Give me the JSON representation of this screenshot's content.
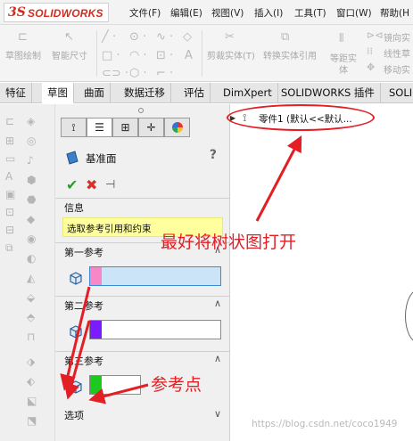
{
  "app": {
    "logo_ds": "3S",
    "logo_text": "SOLIDWORKS"
  },
  "menu": {
    "items": [
      "文件(F)",
      "编辑(E)",
      "视图(V)",
      "插入(I)",
      "工具(T)",
      "窗口(W)",
      "帮助(H"
    ]
  },
  "toolbar": {
    "sketch_draw": "草图绘制",
    "smart_dim": "智能尺寸",
    "trim_entities": "剪裁实体(T)",
    "convert_entities": "转换实体引用",
    "offset_entities_1": "等距实",
    "offset_entities_2": "体",
    "mirror_entities": "镜向实",
    "linear_pattern": "线性草",
    "move_entities": "移动实"
  },
  "tabs": [
    "特征",
    "草图",
    "曲面",
    "数据迁移",
    "评估",
    "DimXpert",
    "SOLIDWORKS 插件",
    "SOLI"
  ],
  "active_tab": 1,
  "panel": {
    "title": "基准面",
    "help": "?",
    "sections": {
      "info": "信息",
      "first_ref": "第一参考",
      "second_ref": "第二参考",
      "third_ref": "第三参考",
      "options": "选项"
    },
    "info_message": "选取参考引用和约束",
    "colors": {
      "first_ref": "#f787c6",
      "second_ref": "#7b1cff",
      "third_ref": "#1ec81e"
    }
  },
  "tree": {
    "part_label": "零件1  (默认<<默认..."
  },
  "annotations": {
    "open_tree": "最好将树状图打开",
    "ref_point": "参考点"
  },
  "watermark": "https://blog.csdn.net/coco1949"
}
